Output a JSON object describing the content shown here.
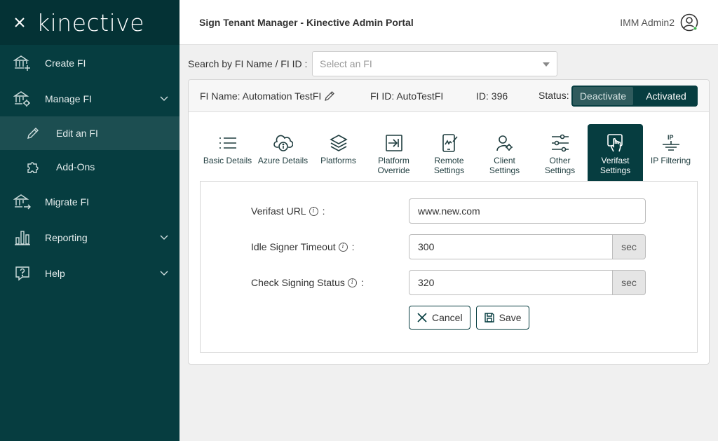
{
  "sidebar": {
    "logo": "kinective",
    "items": [
      {
        "label": "Create FI",
        "icon": "bank-plus-icon"
      },
      {
        "label": "Manage FI",
        "icon": "bank-gear-icon"
      },
      {
        "label": "Edit an FI",
        "icon": "pencil-icon"
      },
      {
        "label": "Add-Ons",
        "icon": "puzzle-icon"
      },
      {
        "label": "Migrate FI",
        "icon": "bank-arrow-icon"
      },
      {
        "label": "Reporting",
        "icon": "bar-chart-icon"
      },
      {
        "label": "Help",
        "icon": "help-bubble-icon"
      }
    ]
  },
  "header": {
    "title": "Sign Tenant Manager - Kinective Admin Portal",
    "user_name": "IMM Admin2"
  },
  "search": {
    "label": "Search by FI Name / FI ID :",
    "placeholder": "Select an FI"
  },
  "fi": {
    "name": "FI Name: Automation TestFI",
    "fi_id": "FI ID: AutoTestFI",
    "id": "ID: 396",
    "status_label": "Status:",
    "deactivate_label": "Deactivate",
    "activated_label": "Activated"
  },
  "tabs": [
    {
      "line1": "Basic Details",
      "line2": "",
      "icon": "list-icon"
    },
    {
      "line1": "Azure Details",
      "line2": "",
      "icon": "cloud-info-icon"
    },
    {
      "line1": "Platforms",
      "line2": "",
      "icon": "layers-icon"
    },
    {
      "line1": "Platform",
      "line2": "Override",
      "icon": "override-icon"
    },
    {
      "line1": "Remote",
      "line2": "Settings",
      "icon": "mobile-sign-icon"
    },
    {
      "line1": "Client",
      "line2": "Settings",
      "icon": "user-gear-icon"
    },
    {
      "line1": "Other",
      "line2": "Settings",
      "icon": "sliders-icon"
    },
    {
      "line1": "Verifast",
      "line2": "Settings",
      "icon": "hand-touch-icon"
    },
    {
      "line1": "IP Filtering",
      "line2": "",
      "icon": "ip-filter-icon"
    }
  ],
  "form": {
    "verifast_url_label": "Verifast URL",
    "verifast_url_value": "www.new.com",
    "idle_timeout_label": "Idle Signer Timeout",
    "idle_timeout_value": "300",
    "idle_timeout_unit": "sec",
    "check_status_label": "Check Signing Status",
    "check_status_value": "320",
    "check_status_unit": "sec",
    "colon": ":",
    "info_glyph": "i",
    "cancel_label": "Cancel",
    "save_label": "Save"
  }
}
